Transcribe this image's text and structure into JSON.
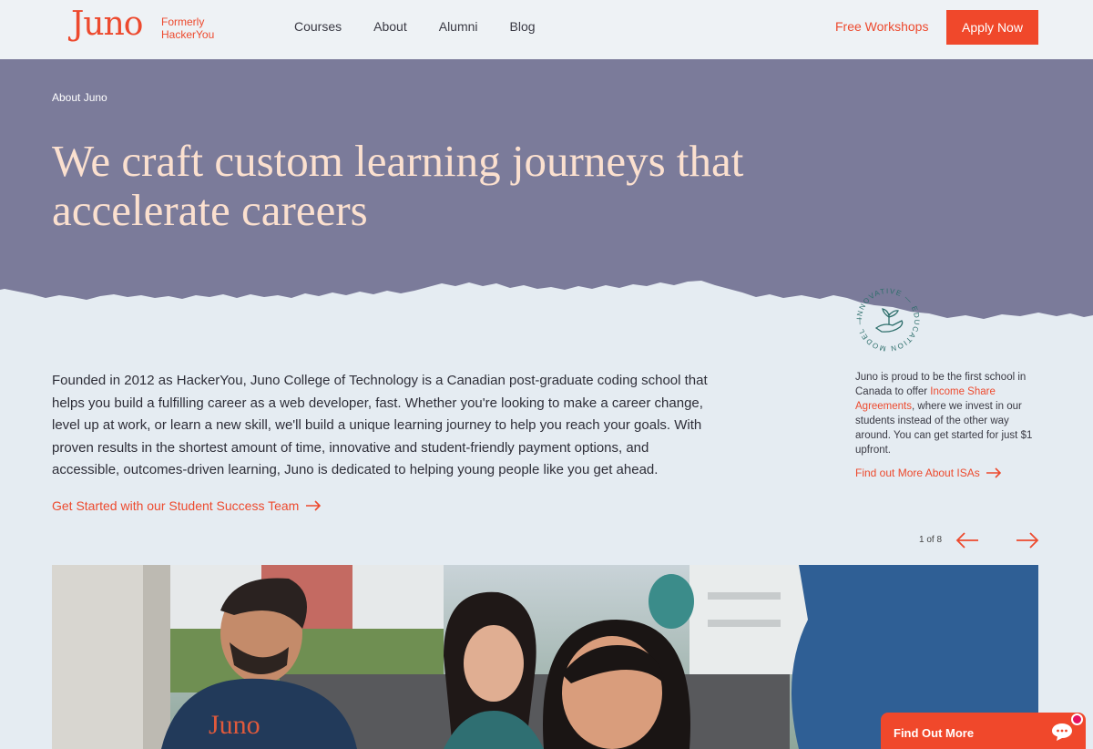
{
  "header": {
    "logo": "Juno",
    "formerly": "Formerly HackerYou",
    "nav": [
      "Courses",
      "About",
      "Alumni",
      "Blog"
    ],
    "free_workshops": "Free Workshops",
    "apply_now": "Apply Now"
  },
  "hero": {
    "breadcrumb": "About Juno",
    "title": "We craft custom learning journeys that accelerate careers",
    "background_color": "#7b7b9a",
    "title_color": "#fbe0cf"
  },
  "badge": {
    "text": "INNOVATIVE — EDUCATION MODEL —"
  },
  "main": {
    "intro": "Founded in 2012 as HackerYou, Juno College of Technology is a Canadian post-graduate coding school that helps you build a fulfilling career as a web developer, fast. Whether you're looking to make a career change, level up at work, or learn a new skill, we'll build a unique learning journey to help you reach your goals. With proven results in the shortest amount of time, innovative and student-friendly payment options, and accessible, outcomes-driven learning, Juno is dedicated to helping young people like you get ahead.",
    "cta": "Get Started with our Student Success Team"
  },
  "sidebar": {
    "text_before": "Juno is proud to be the first school in Canada to offer ",
    "link": "Income Share Agreements",
    "text_after": ", where we invest in our students instead of the other way around. You can get started for just $1 upfront.",
    "cta": "Find out More About ISAs"
  },
  "carousel": {
    "counter": "1 of 8",
    "prev_icon": "arrow-left-icon",
    "next_icon": "arrow-right-icon"
  },
  "chat": {
    "label": "Find Out More",
    "icon": "chat-bubble-icon"
  },
  "colors": {
    "accent": "#f0482b",
    "background": "#e5ecf2"
  }
}
